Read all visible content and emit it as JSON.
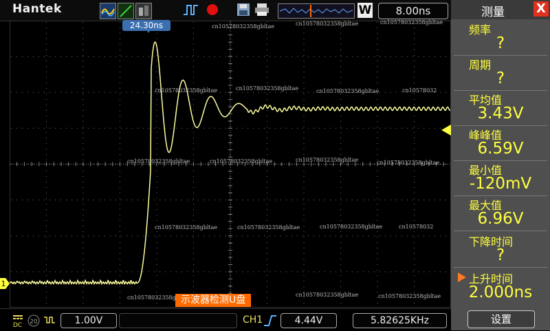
{
  "brand": "Hantek",
  "timebase": "8.00ns",
  "mode_button_letter": "W",
  "trigger_time": "24.30ns",
  "usb_banner": "示波器检测U盘",
  "bottom": {
    "coupling": "DC",
    "channel_number": "20",
    "volts_per_div": "1.00V",
    "trigger_source": "CH1",
    "trigger_level": "4.44V",
    "frequency": "5.82625KHz"
  },
  "markers": {
    "channel": "1"
  },
  "watermark": {
    "long": "cn10578032358gbltae",
    "short": "cn10578032"
  },
  "panel": {
    "title": "测量",
    "close": "X",
    "settings": "设置",
    "items": [
      {
        "label": "频率",
        "value": "?"
      },
      {
        "label": "周期",
        "value": "?"
      },
      {
        "label": "平均值",
        "value": "3.43V"
      },
      {
        "label": "峰峰值",
        "value": "6.59V"
      },
      {
        "label": "最小值",
        "value": "-120mV"
      },
      {
        "label": "最大值",
        "value": "6.96V"
      },
      {
        "label": "下降时间",
        "value": "?"
      },
      {
        "label": "上升时间",
        "value": "2.000ns"
      }
    ]
  },
  "colors": {
    "trace": "#ffffa0",
    "accent": "#ffff40",
    "banner": "#ff6a00",
    "close": "#e0301e"
  }
}
